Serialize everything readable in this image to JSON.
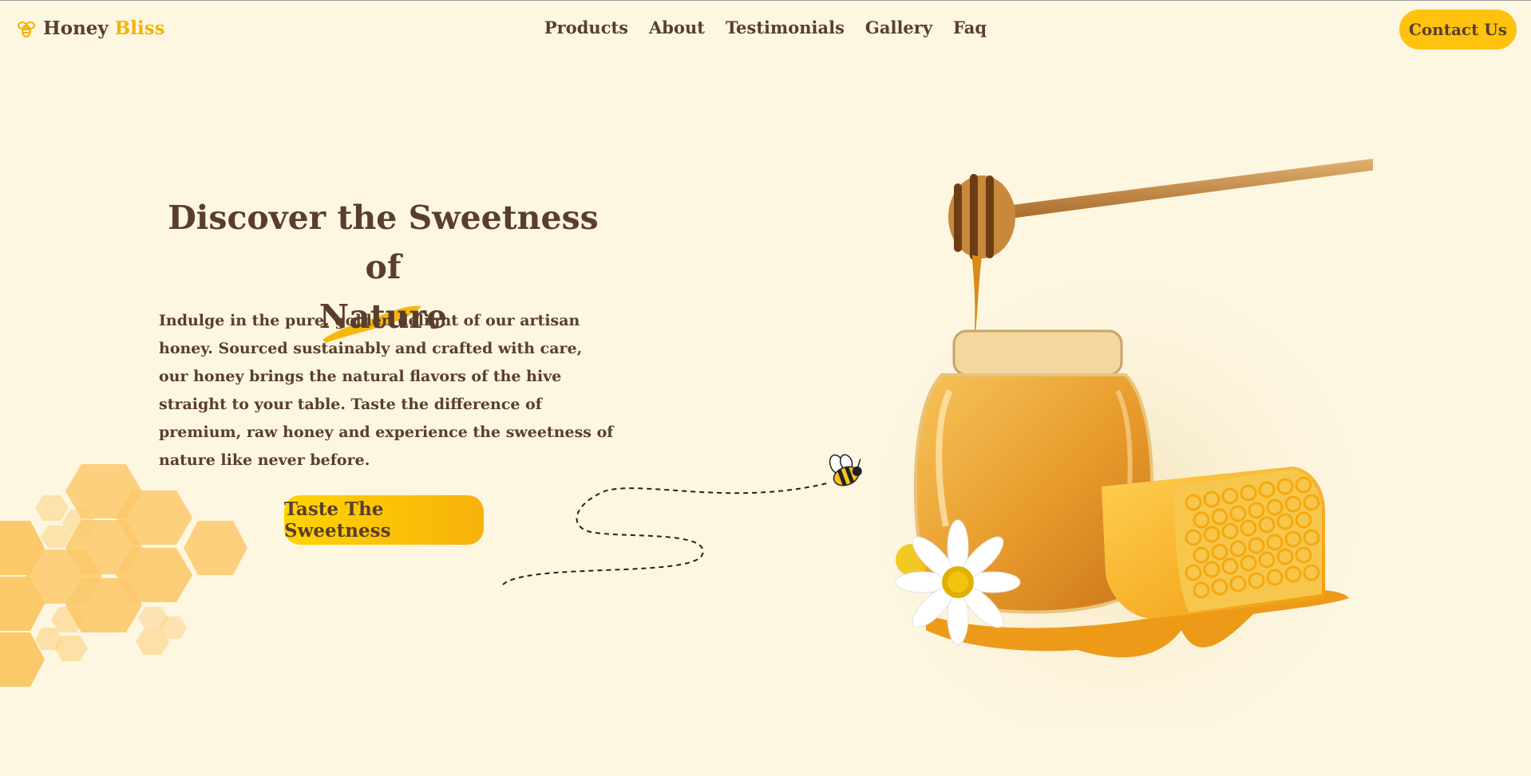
{
  "brand": {
    "word1": "Honey",
    "word2": "Bliss",
    "icon": "bee-logo-icon",
    "accent": "#f4b400"
  },
  "nav": {
    "items": [
      "Products",
      "About",
      "Testimonials",
      "Gallery",
      "Faq"
    ]
  },
  "header": {
    "contact_label": "Contact Us"
  },
  "hero": {
    "title_main": "Discover the Sweetness of",
    "title_highlight": "Nature",
    "description": "Indulge in the pure, golden delight of our artisan honey. Sourced sustainably and crafted with care, our honey brings the natural flavors of the hive straight to your table. Taste the difference of premium, raw honey and experience the sweetness of nature like never before.",
    "cta_label": "Taste The Sweetness"
  },
  "colors": {
    "background": "#fdf6e1",
    "text": "#5a3e2b",
    "button": "#ffc20e",
    "honeycomb": "#fbc96a"
  }
}
